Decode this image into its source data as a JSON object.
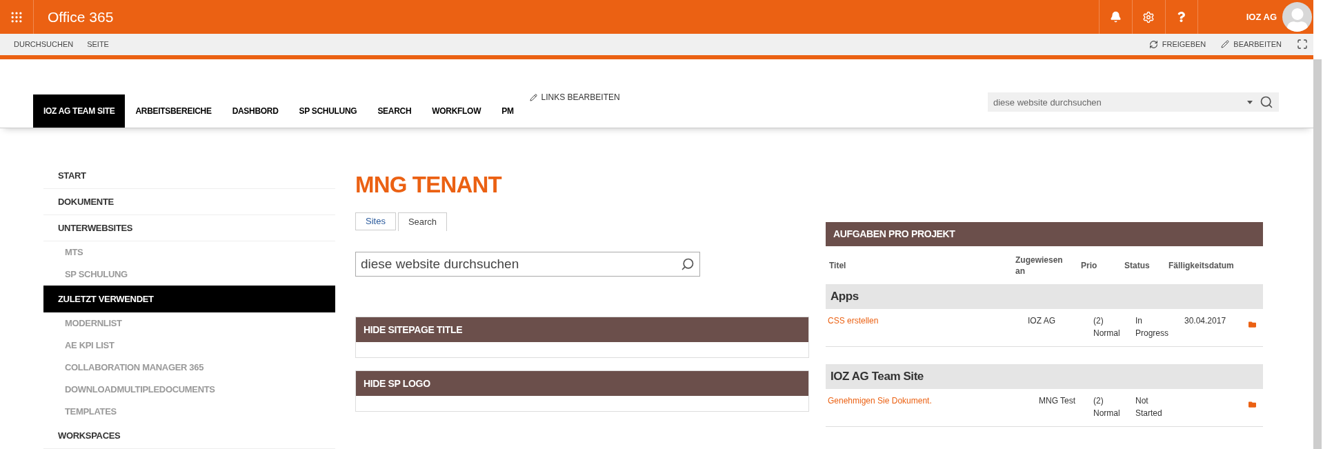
{
  "suite_bar": {
    "title": "Office 365",
    "user": "IOZ AG"
  },
  "ribbon": {
    "tabs": [
      {
        "label": "DURCHSUCHEN"
      },
      {
        "label": "SEITE"
      }
    ],
    "actions": [
      {
        "label": "FREIGEBEN",
        "kind": "share"
      },
      {
        "label": "BEARBEITEN",
        "kind": "edit"
      }
    ]
  },
  "top_nav": {
    "items": [
      {
        "label": "IOZ AG TEAM SITE",
        "selected": true
      },
      {
        "label": "ARBEITSBEREICHE",
        "selected": false
      },
      {
        "label": "DASHBORD",
        "selected": false
      },
      {
        "label": "SP SCHULUNG",
        "selected": false
      },
      {
        "label": "SEARCH",
        "selected": false
      },
      {
        "label": "WORKFLOW",
        "selected": false
      },
      {
        "label": "PM",
        "selected": false
      }
    ],
    "edit_links": "LINKS BEARBEITEN",
    "search": {
      "placeholder": "diese website durchsuchen"
    }
  },
  "quick_launch": {
    "items": [
      {
        "label": "START",
        "selected": false
      },
      {
        "label": "DOKUMENTE",
        "selected": false
      },
      {
        "label": "UNTERWEBSITES",
        "selected": false,
        "children": [
          {
            "label": "MTS",
            "selected": false
          },
          {
            "label": "SP SCHULUNG",
            "selected": false
          }
        ]
      },
      {
        "label": "ZULETZT VERWENDET",
        "selected": true,
        "children": [
          {
            "label": "MODERNLIST",
            "selected": false
          },
          {
            "label": "AE KPI LIST",
            "selected": false
          },
          {
            "label": "COLLABORATION MANAGER 365",
            "selected": false
          },
          {
            "label": "DOWNLOADMULTIPLEDOCUMENTS",
            "selected": false
          },
          {
            "label": "TEMPLATES",
            "selected": false
          }
        ]
      },
      {
        "label": "WORKSPACES",
        "selected": false
      }
    ]
  },
  "main": {
    "page_title": "MNG TENANT",
    "tabs": [
      {
        "label": "Sites",
        "selected": false
      },
      {
        "label": "Search",
        "selected": true
      }
    ],
    "search_box": {
      "placeholder": "diese website durchsuchen"
    },
    "webparts": [
      {
        "title": "HIDE SITEPAGE TITLE"
      },
      {
        "title": "HIDE SP LOGO"
      }
    ]
  },
  "tasks": {
    "title": "AUFGABEN PRO PROJEKT",
    "columns": [
      "Titel",
      "Zugewiesen an",
      "Prio",
      "Status",
      "Fälligkeitsdatum"
    ],
    "groups": [
      {
        "name": "Apps",
        "rows": [
          {
            "title": "CSS erstellen",
            "assigned": "IOZ AG",
            "prio": "(2) Normal",
            "status": "In Progress",
            "due": "30.04.2017"
          }
        ]
      },
      {
        "name": "IOZ AG Team Site",
        "rows": [
          {
            "title": "Genehmigen Sie Dokument.",
            "assigned": "MNG Test",
            "prio": "(2) Normal",
            "status": "Not Started"
          }
        ]
      }
    ]
  }
}
